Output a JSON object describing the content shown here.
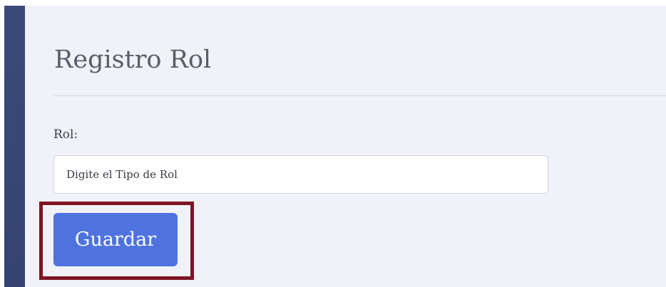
{
  "page": {
    "title": "Registro Rol"
  },
  "form": {
    "role_label": "Rol:",
    "role_input": {
      "value": "",
      "placeholder": "Digite el Tipo de Rol"
    },
    "save_label": "Guardar"
  },
  "colors": {
    "sidebar": "#3b4b79",
    "content_background": "#f1f2f8",
    "primary_button": "#4e73df",
    "highlight_outline": "#7f1423"
  }
}
